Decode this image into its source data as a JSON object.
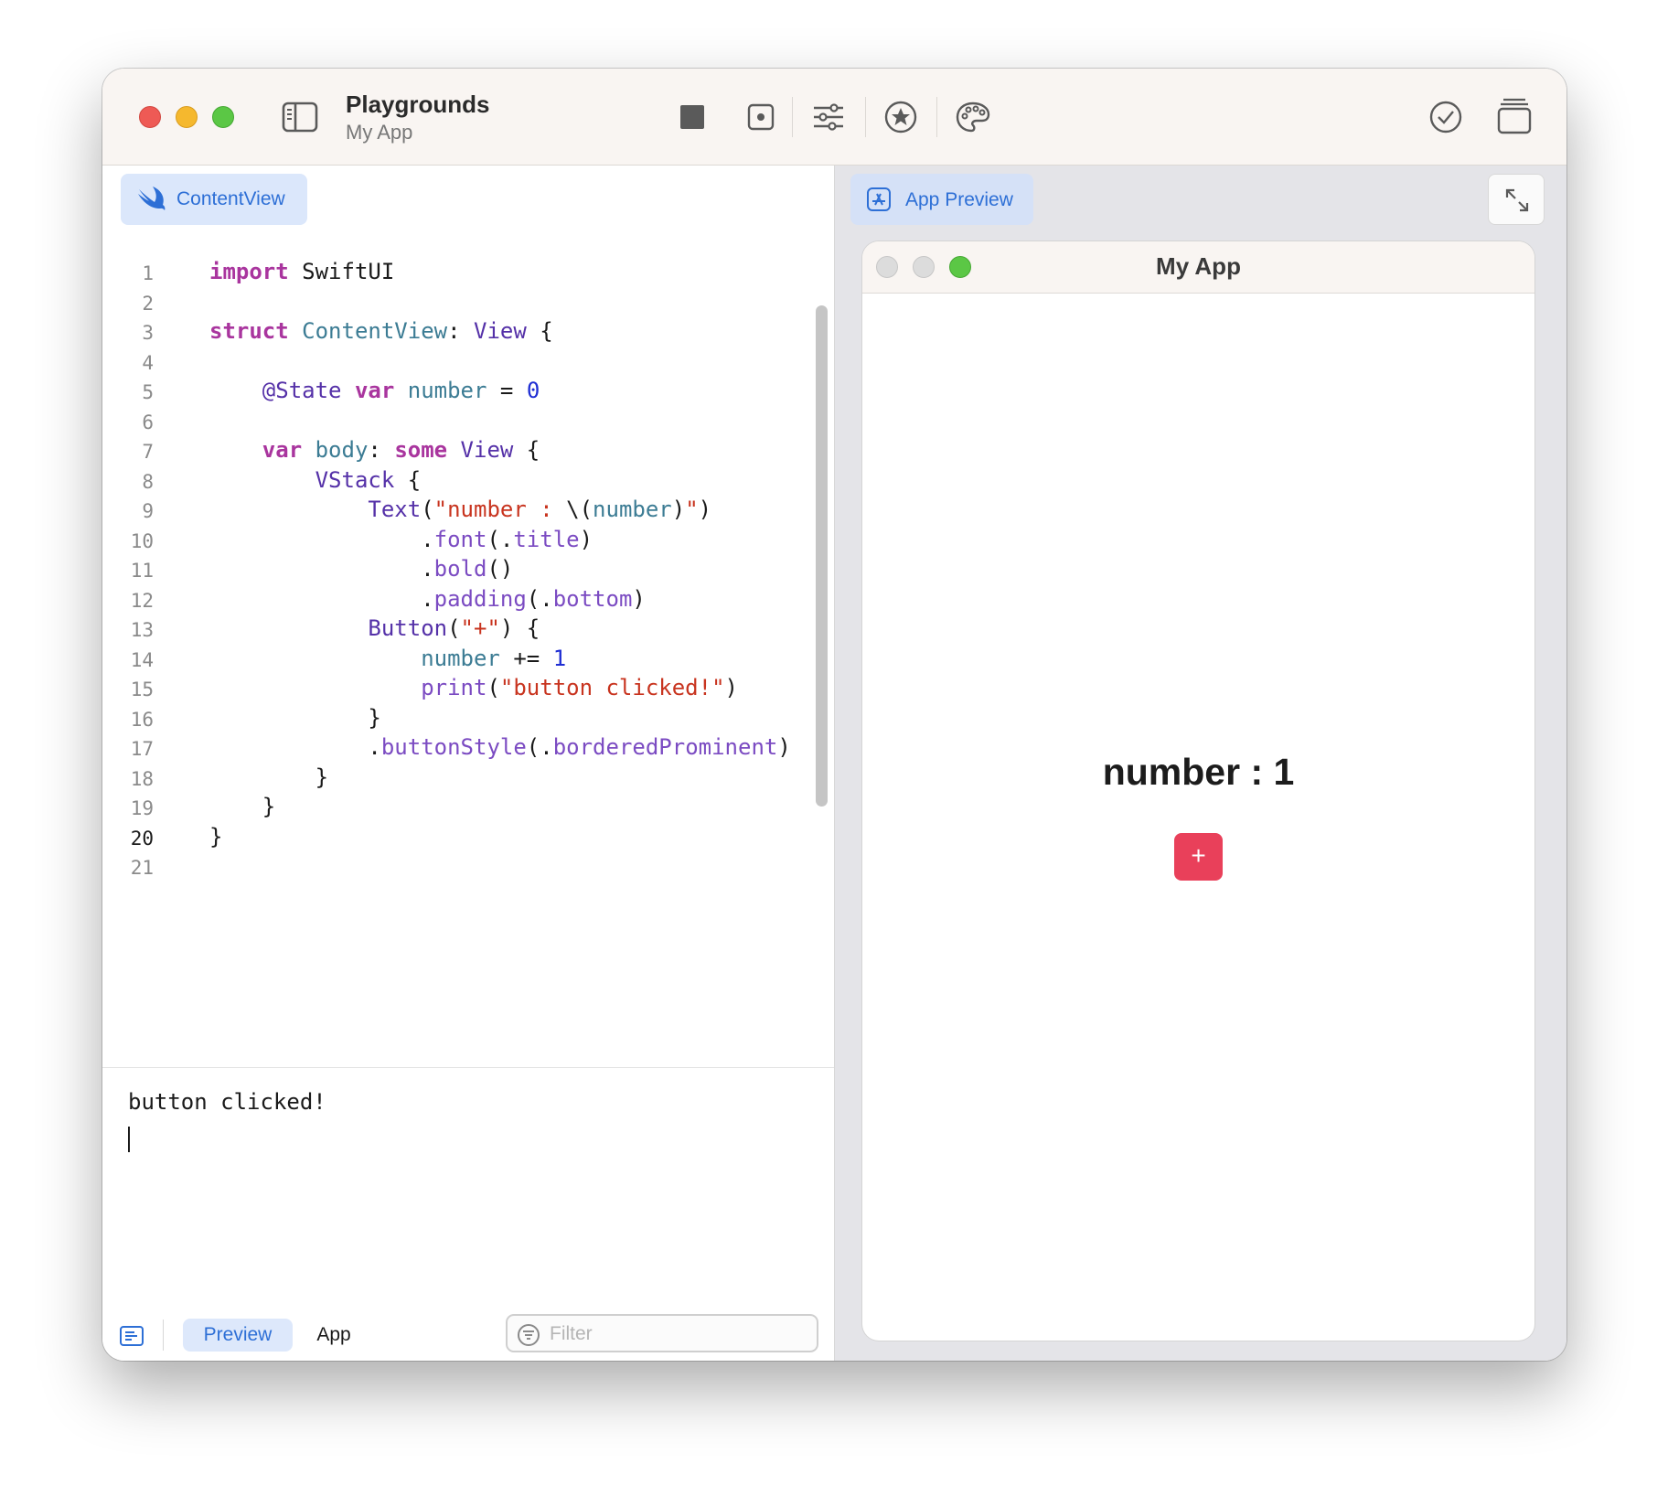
{
  "toolbar": {
    "title": "Playgrounds",
    "subtitle": "My App"
  },
  "editor": {
    "file_tab_label": "ContentView",
    "lines": [
      {
        "n": "1"
      },
      {
        "n": "2"
      },
      {
        "n": "3"
      },
      {
        "n": "4"
      },
      {
        "n": "5"
      },
      {
        "n": "6"
      },
      {
        "n": "7"
      },
      {
        "n": "8"
      },
      {
        "n": "9"
      },
      {
        "n": "10"
      },
      {
        "n": "11"
      },
      {
        "n": "12"
      },
      {
        "n": "13"
      },
      {
        "n": "14"
      },
      {
        "n": "15"
      },
      {
        "n": "16"
      },
      {
        "n": "17"
      },
      {
        "n": "18"
      },
      {
        "n": "19"
      },
      {
        "n": "20"
      },
      {
        "n": "21"
      }
    ],
    "current_line": "20",
    "code": {
      "l1_kw": "import",
      "l1_rest": " SwiftUI",
      "l3_kw": "struct",
      "l3_name": " ContentView",
      "l3_colon": ": ",
      "l3_type": "View",
      "l3_brace": " {",
      "l5_attr": "@State",
      "l5_kw": " var",
      "l5_name": " number",
      "l5_eq": " = ",
      "l5_num": "0",
      "l7_kw": "var",
      "l7_name": " body",
      "l7_colon": ": ",
      "l7_kw2": "some",
      "l7_type": " View",
      "l7_brace": " {",
      "l8_type": "VStack",
      "l8_brace": " {",
      "l9_type": "Text",
      "l9_p1": "(",
      "l9_str1": "\"number : ",
      "l9_interp": "\\(",
      "l9_var": "number",
      "l9_interp_close": ")",
      "l9_str2": "\"",
      "l9_p2": ")",
      "l10_dot": ".",
      "l10_fn": "font",
      "l10_p1": "(.",
      "l10_arg": "title",
      "l10_p2": ")",
      "l11_dot": ".",
      "l11_fn": "bold",
      "l11_p": "()",
      "l12_dot": ".",
      "l12_fn": "padding",
      "l12_p1": "(.",
      "l12_arg": "bottom",
      "l12_p2": ")",
      "l13_type": "Button",
      "l13_p1": "(",
      "l13_str": "\"+\"",
      "l13_p2": ") {",
      "l14_var": "number",
      "l14_op": " += ",
      "l14_num": "1",
      "l15_fn": "print",
      "l15_p1": "(",
      "l15_str": "\"button clicked!\"",
      "l15_p2": ")",
      "l16": "}",
      "l17_dot": ".",
      "l17_fn": "buttonStyle",
      "l17_p1": "(.",
      "l17_arg": "borderedProminent",
      "l17_p2": ")",
      "l18": "}",
      "l19": "}",
      "l20": "}"
    },
    "console_output": "button clicked!"
  },
  "bottom_bar": {
    "preview_label": "Preview",
    "app_label": "App",
    "filter_placeholder": "Filter"
  },
  "preview": {
    "tab_label": "App Preview",
    "window_title": "My App",
    "number_text": "number : 1",
    "plus_label": "+",
    "button_color": "#e9405a"
  },
  "colors": {
    "accent": "#2d6fd6",
    "keyword": "#a9359e",
    "string": "#c8341f",
    "number": "#1f2ed3"
  }
}
